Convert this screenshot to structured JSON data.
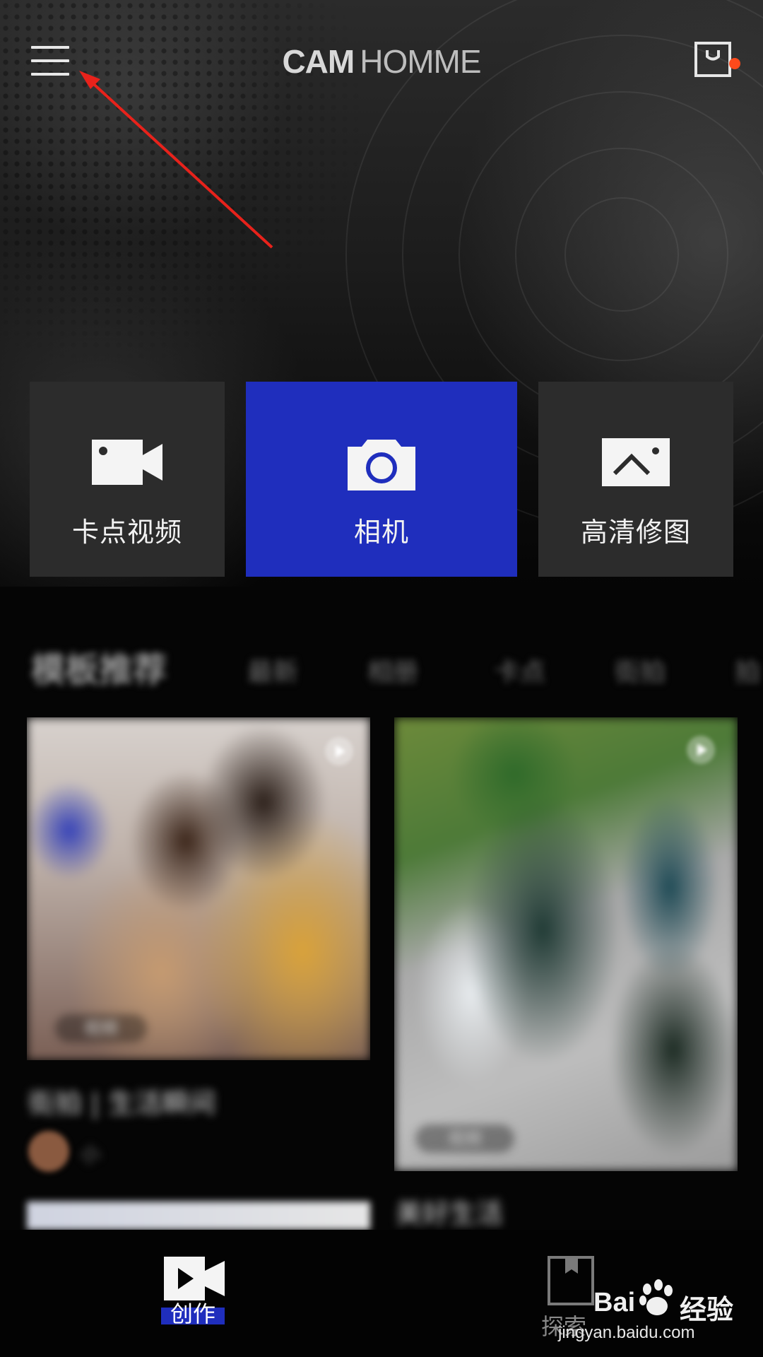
{
  "header": {
    "logo_bold": "CAM",
    "logo_light": "HOMME",
    "menu_icon": "hamburger-menu-icon",
    "bag_icon": "shopping-bag-icon",
    "notification_color": "#ff4a1c"
  },
  "tools": [
    {
      "label": "卡点视频",
      "icon": "video-camera-icon"
    },
    {
      "label": "相机",
      "icon": "camera-icon",
      "active": true,
      "color": "#1f2ebd"
    },
    {
      "label": "高清修图",
      "icon": "photo-edit-icon"
    }
  ],
  "tabs": {
    "main": "模板推荐",
    "items": [
      "最新",
      "相册",
      "卡点",
      "街拍",
      "拍"
    ]
  },
  "cards": [
    {
      "title": "街拍 | 生活瞬间",
      "tag": "视频",
      "author": "小"
    },
    {
      "title": "美好生活",
      "tag": "视频"
    }
  ],
  "bottom_nav": {
    "create": "创作",
    "explore": "探索",
    "accent": "#1f2ebd"
  },
  "watermark": {
    "brand": "Bai",
    "brand_cn": "经验",
    "url": "jingyan.baidu.com"
  }
}
